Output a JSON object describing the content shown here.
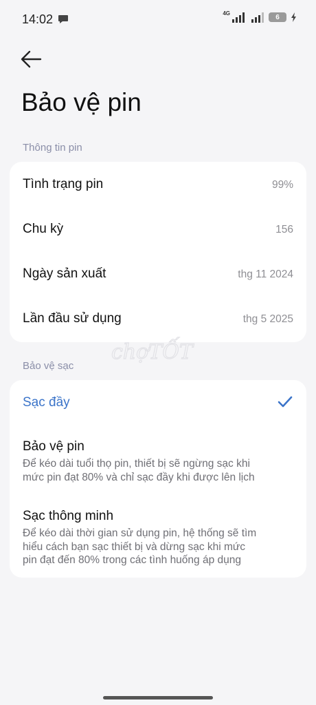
{
  "status_bar": {
    "time": "14:02",
    "network": "4G",
    "battery_level": "6"
  },
  "page": {
    "title": "Bảo vệ pin"
  },
  "battery_info": {
    "section_title": "Thông tin pin",
    "rows": [
      {
        "label": "Tình trạng pin",
        "value": "99%"
      },
      {
        "label": "Chu kỳ",
        "value": "156"
      },
      {
        "label": "Ngày sản xuất",
        "value": "thg 11 2024"
      },
      {
        "label": "Lần đầu sử dụng",
        "value": "thg 5 2025"
      }
    ]
  },
  "charging_protection": {
    "section_title": "Bảo vệ sạc",
    "options": [
      {
        "title": "Sạc đầy",
        "selected": true
      },
      {
        "title": "Bảo vệ pin",
        "desc_line1": "Để kéo dài tuổi thọ pin, thiết bị sẽ ngừng sạc khi",
        "desc_line2": "mức pin đạt 80% và chỉ sạc đầy khi được lên lịch"
      },
      {
        "title": "Sạc thông minh",
        "desc_line1": "Để kéo dài thời gian sử dụng pin, hệ thống sẽ tìm",
        "desc_line2": "hiểu cách bạn sạc thiết bị và dừng sạc khi mức",
        "desc_line3": "pin đạt đến 80% trong các tình huống áp dụng"
      }
    ]
  },
  "colors": {
    "accent": "#3b74c9",
    "background": "#f5f5f7",
    "card": "#ffffff",
    "section_header": "#8a8ea8",
    "secondary_text": "#8e8e93"
  },
  "icons": {
    "back": "arrow-left-icon",
    "check": "checkmark-icon",
    "chat": "chat-bubble-icon",
    "signal": "signal-bars-icon",
    "charging": "lightning-icon"
  },
  "watermark": "chợTỐT"
}
